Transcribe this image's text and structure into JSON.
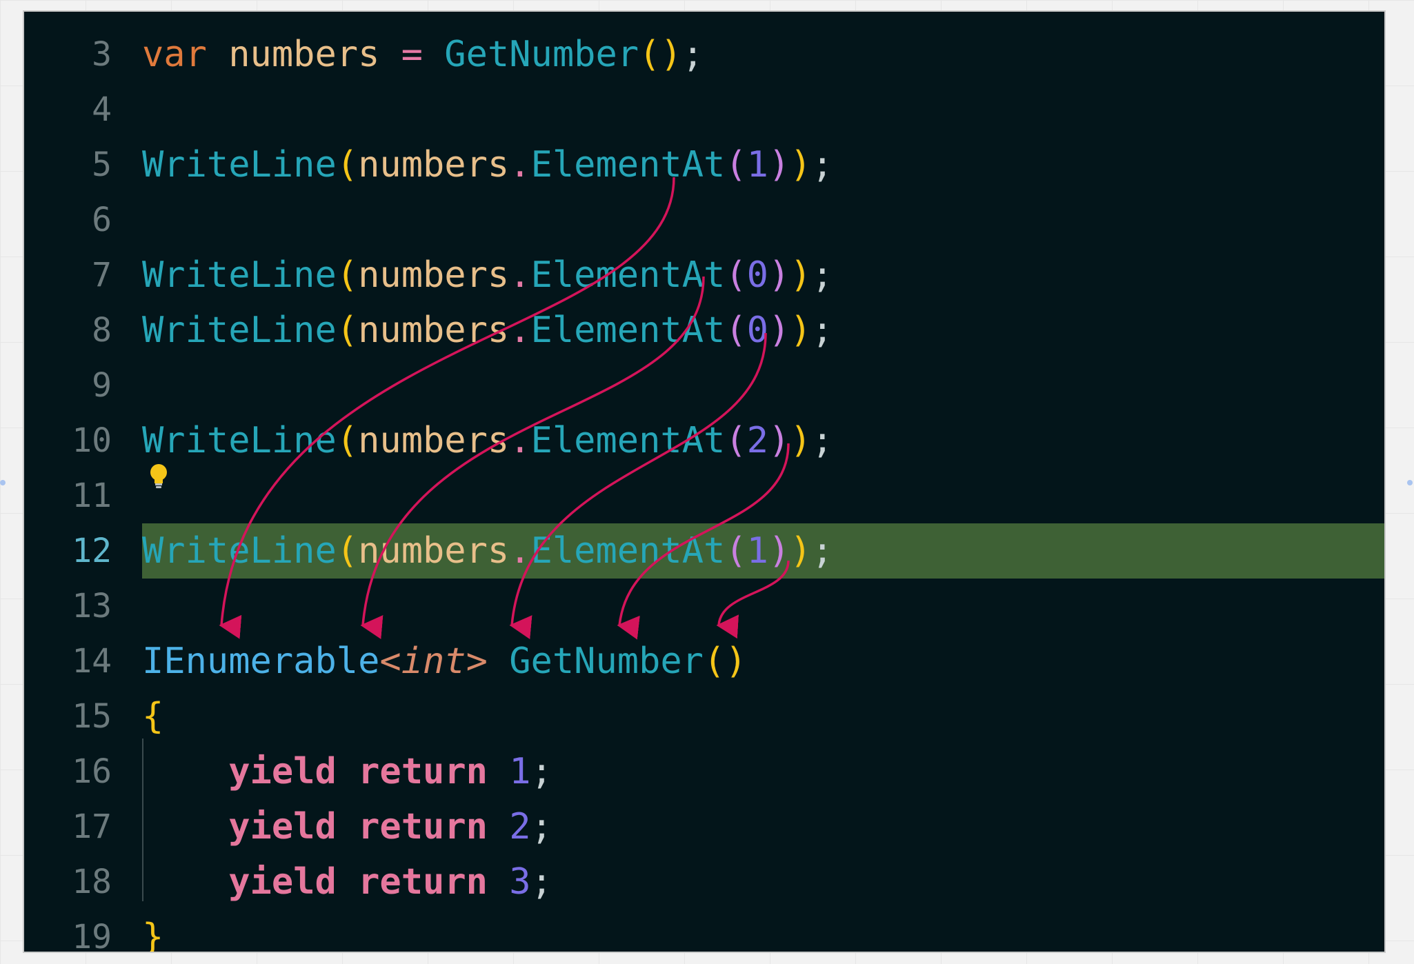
{
  "editor": {
    "lines": [
      {
        "num": "3",
        "tokens": [
          [
            "kw-var",
            "var"
          ],
          [
            "ident",
            " numbers"
          ],
          [
            "op",
            " ="
          ],
          [
            "fn",
            " GetNumber"
          ],
          [
            "paren1",
            "("
          ],
          [
            "paren1",
            ")"
          ],
          [
            "punct",
            ";"
          ]
        ]
      },
      {
        "num": "4",
        "tokens": []
      },
      {
        "num": "5",
        "tokens": [
          [
            "fn",
            "WriteLine"
          ],
          [
            "paren1",
            "("
          ],
          [
            "ident",
            "numbers"
          ],
          [
            "op",
            "."
          ],
          [
            "fn",
            "ElementAt"
          ],
          [
            "paren2",
            "("
          ],
          [
            "num",
            "1"
          ],
          [
            "paren2",
            ")"
          ],
          [
            "paren1",
            ")"
          ],
          [
            "punct",
            ";"
          ]
        ]
      },
      {
        "num": "6",
        "tokens": []
      },
      {
        "num": "7",
        "tokens": [
          [
            "fn",
            "WriteLine"
          ],
          [
            "paren1",
            "("
          ],
          [
            "ident",
            "numbers"
          ],
          [
            "op",
            "."
          ],
          [
            "fn",
            "ElementAt"
          ],
          [
            "paren2",
            "("
          ],
          [
            "num",
            "0"
          ],
          [
            "paren2",
            ")"
          ],
          [
            "paren1",
            ")"
          ],
          [
            "punct",
            ";"
          ]
        ]
      },
      {
        "num": "8",
        "tokens": [
          [
            "fn",
            "WriteLine"
          ],
          [
            "paren1",
            "("
          ],
          [
            "ident",
            "numbers"
          ],
          [
            "op",
            "."
          ],
          [
            "fn",
            "ElementAt"
          ],
          [
            "paren2",
            "("
          ],
          [
            "num",
            "0"
          ],
          [
            "paren2",
            ")"
          ],
          [
            "paren1",
            ")"
          ],
          [
            "punct",
            ";"
          ]
        ]
      },
      {
        "num": "9",
        "tokens": []
      },
      {
        "num": "10",
        "tokens": [
          [
            "fn",
            "WriteLine"
          ],
          [
            "paren1",
            "("
          ],
          [
            "ident",
            "numbers"
          ],
          [
            "op",
            "."
          ],
          [
            "fn",
            "ElementAt"
          ],
          [
            "paren2",
            "("
          ],
          [
            "num",
            "2"
          ],
          [
            "paren2",
            ")"
          ],
          [
            "paren1",
            ")"
          ],
          [
            "punct",
            ";"
          ]
        ]
      },
      {
        "num": "11",
        "tokens": []
      },
      {
        "num": "12",
        "current": true,
        "tokens": [
          [
            "fn",
            "WriteLine"
          ],
          [
            "paren1",
            "("
          ],
          [
            "ident",
            "numbers"
          ],
          [
            "op",
            "."
          ],
          [
            "fn",
            "ElementAt"
          ],
          [
            "paren2",
            "("
          ],
          [
            "num",
            "1"
          ],
          [
            "paren2",
            ")"
          ],
          [
            "paren1",
            ")"
          ],
          [
            "punct",
            ";"
          ]
        ]
      },
      {
        "num": "13",
        "tokens": []
      },
      {
        "num": "14",
        "tokens": [
          [
            "type",
            "IEnumerable"
          ],
          [
            "gen",
            "<"
          ],
          [
            "gen-type",
            "int"
          ],
          [
            "gen",
            ">"
          ],
          [
            "fn",
            " GetNumber"
          ],
          [
            "paren1",
            "("
          ],
          [
            "paren1",
            ")"
          ]
        ]
      },
      {
        "num": "15",
        "tokens": [
          [
            "brace",
            "{"
          ]
        ]
      },
      {
        "num": "16",
        "tokens": [
          [
            "punct",
            "    "
          ],
          [
            "kw-yield",
            "yield"
          ],
          [
            "kw-yield",
            " return"
          ],
          [
            "num",
            " 1"
          ],
          [
            "punct",
            ";"
          ]
        ]
      },
      {
        "num": "17",
        "tokens": [
          [
            "punct",
            "    "
          ],
          [
            "kw-yield",
            "yield"
          ],
          [
            "kw-yield",
            " return"
          ],
          [
            "num",
            " 2"
          ],
          [
            "punct",
            ";"
          ]
        ]
      },
      {
        "num": "18",
        "tokens": [
          [
            "punct",
            "    "
          ],
          [
            "kw-yield",
            "yield"
          ],
          [
            "kw-yield",
            " return"
          ],
          [
            "num",
            " 3"
          ],
          [
            "punct",
            ";"
          ]
        ]
      },
      {
        "num": "19",
        "tokens": [
          [
            "brace",
            "}"
          ]
        ]
      }
    ]
  },
  "icons": {
    "lightbulb": "lightbulb-icon"
  },
  "colors": {
    "background": "#03151a",
    "highlight": "#3e6135",
    "arrow": "#d4145a"
  }
}
